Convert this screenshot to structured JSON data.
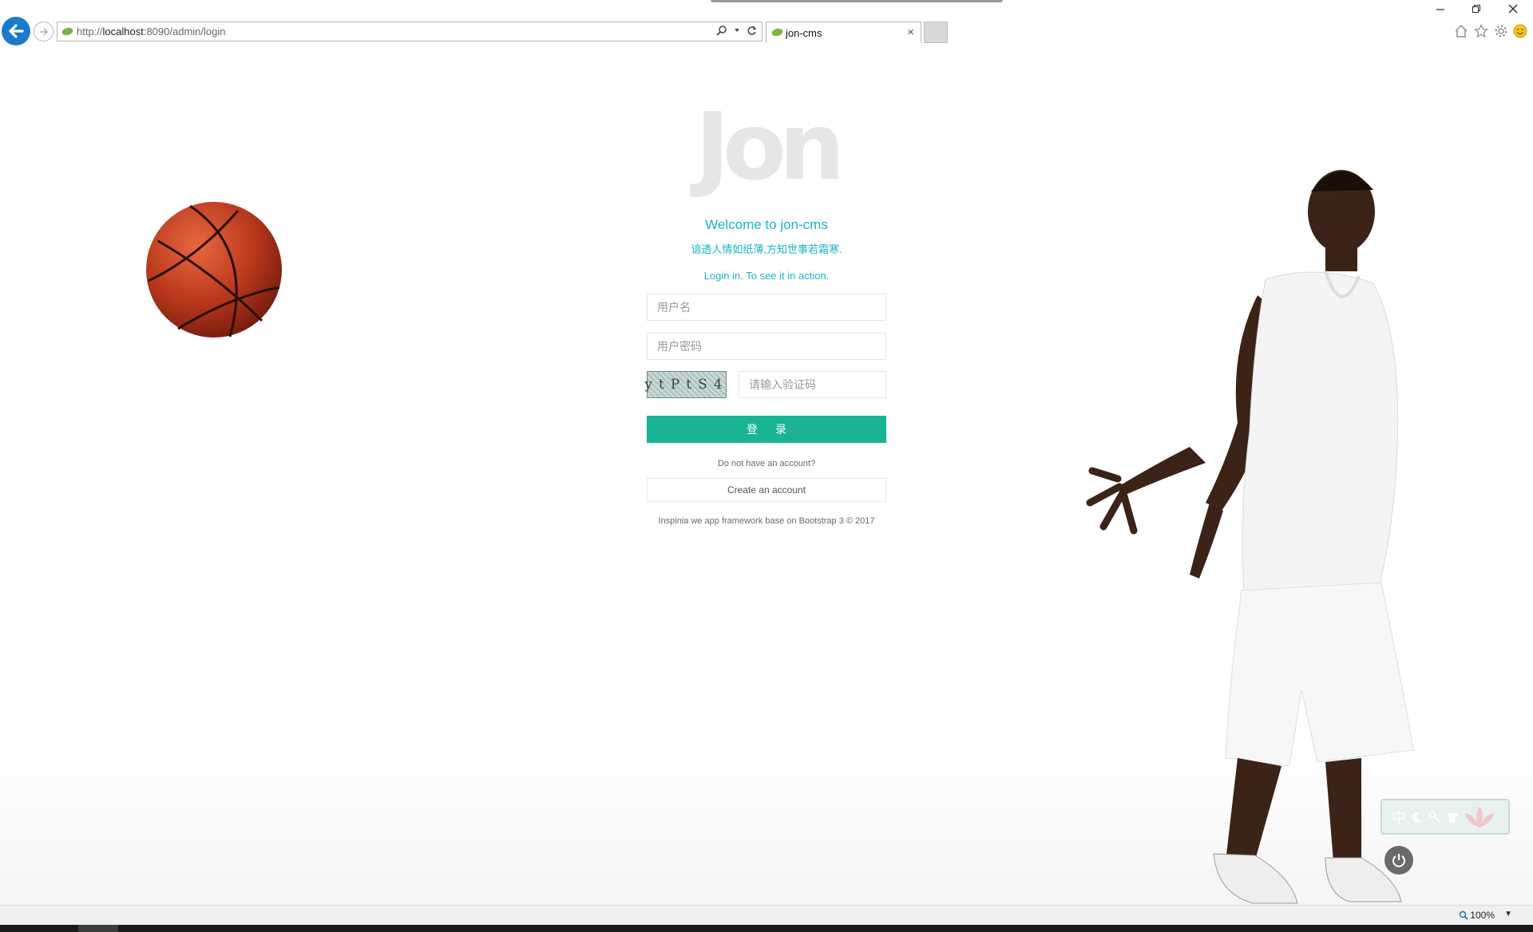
{
  "browser": {
    "url_prefix": "http://",
    "url_host": "localhost",
    "url_rest": ":8090/admin/login",
    "tab_title": "jon-cms",
    "zoom": "100%"
  },
  "login": {
    "logo": "Jon",
    "welcome": "Welcome to jon-cms",
    "quote": "谙透人情如纸薄,方知世事若霜寒.",
    "tagline": "Login in. To see it in action.",
    "username_placeholder": "用户名",
    "password_placeholder": "用户密码",
    "captcha_text": "ytPtS4",
    "captcha_placeholder": "请输入验证码",
    "login_button": "登录",
    "no_account": "Do not have an account?",
    "create_account": "Create an account",
    "copyright": "Inspinia we app framework base on Bootstrap 3 © 2017"
  },
  "colors": {
    "accent": "#1ab5c6",
    "primary_button": "#1ab394",
    "logo_gray": "#e6e6e6"
  }
}
